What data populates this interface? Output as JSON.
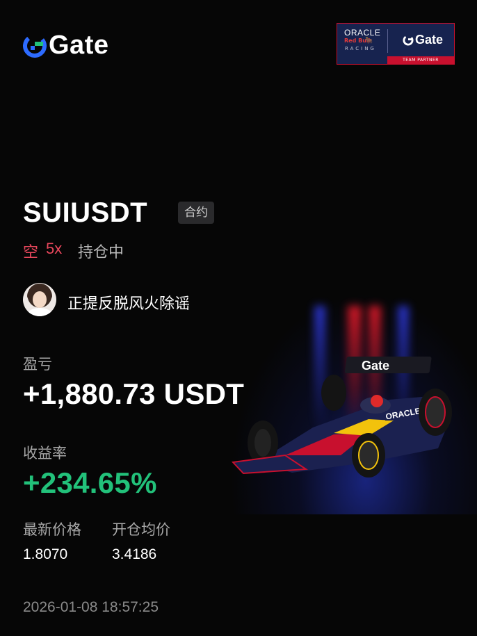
{
  "brand": {
    "name": "Gate",
    "accent": "#2d6bff"
  },
  "partner_banner": {
    "oracle": "ORACLE",
    "red_bull": "Red Bull",
    "racing": "RACING",
    "gate": "Gate",
    "team_partner": "TEAM PARTNER"
  },
  "position": {
    "symbol": "SUIUSDT",
    "type_badge": "合约",
    "direction": "空",
    "leverage": "5x",
    "status": "持仓中",
    "direction_color": "#e8475c"
  },
  "user": {
    "nickname": "正提反脱风火除谣"
  },
  "pnl": {
    "label": "盈亏",
    "value": "+1,880.73 USDT"
  },
  "roi": {
    "label": "收益率",
    "value": "+234.65%",
    "color": "#22c17a"
  },
  "prices": {
    "latest_label": "最新价格",
    "latest_value": "1.8070",
    "entry_label": "开仓均价",
    "entry_value": "3.4186"
  },
  "timestamp": "2026-01-08 18:57:25",
  "car_livery": {
    "wing_text": "Gate",
    "sidepod_text": "ORACLE"
  }
}
